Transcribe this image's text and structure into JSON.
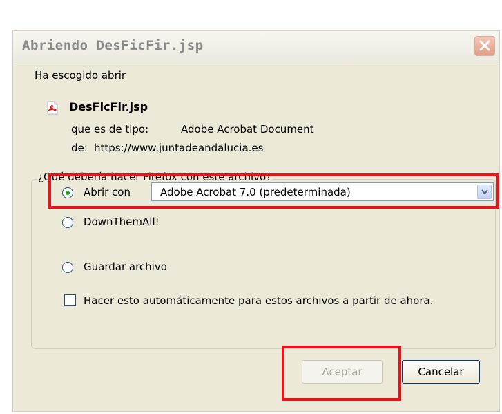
{
  "dialog": {
    "title": "Abriendo DesFicFir.jsp",
    "intro": "Ha escogido abrir",
    "file": {
      "name": "DesFicFir.jsp",
      "type_label": "que es de tipo:",
      "type_value": "Adobe Acrobat Document",
      "from_label": "de:",
      "from_value": "https://www.juntadeandalucia.es"
    },
    "question": "¿Qué debería hacer Firefox con este archivo?",
    "options": {
      "open_with_label": "Abrir con",
      "open_with_app": "Adobe Acrobat 7.0 (predeterminada)",
      "downthemall_label": "DownThemAll!",
      "save_label": "Guardar archivo",
      "selected": "open_with"
    },
    "auto_checkbox_label": "Hacer esto automáticamente para estos archivos a partir de ahora.",
    "auto_checked": false,
    "buttons": {
      "accept": "Aceptar",
      "cancel": "Cancelar"
    }
  },
  "colors": {
    "highlight": "#e8141c",
    "dialog_bg": "#ece9d8",
    "radio_checked": "#21a121"
  },
  "icons": {
    "file": "pdf-file-icon",
    "close": "close-icon",
    "dropdown": "chevron-down-icon"
  }
}
